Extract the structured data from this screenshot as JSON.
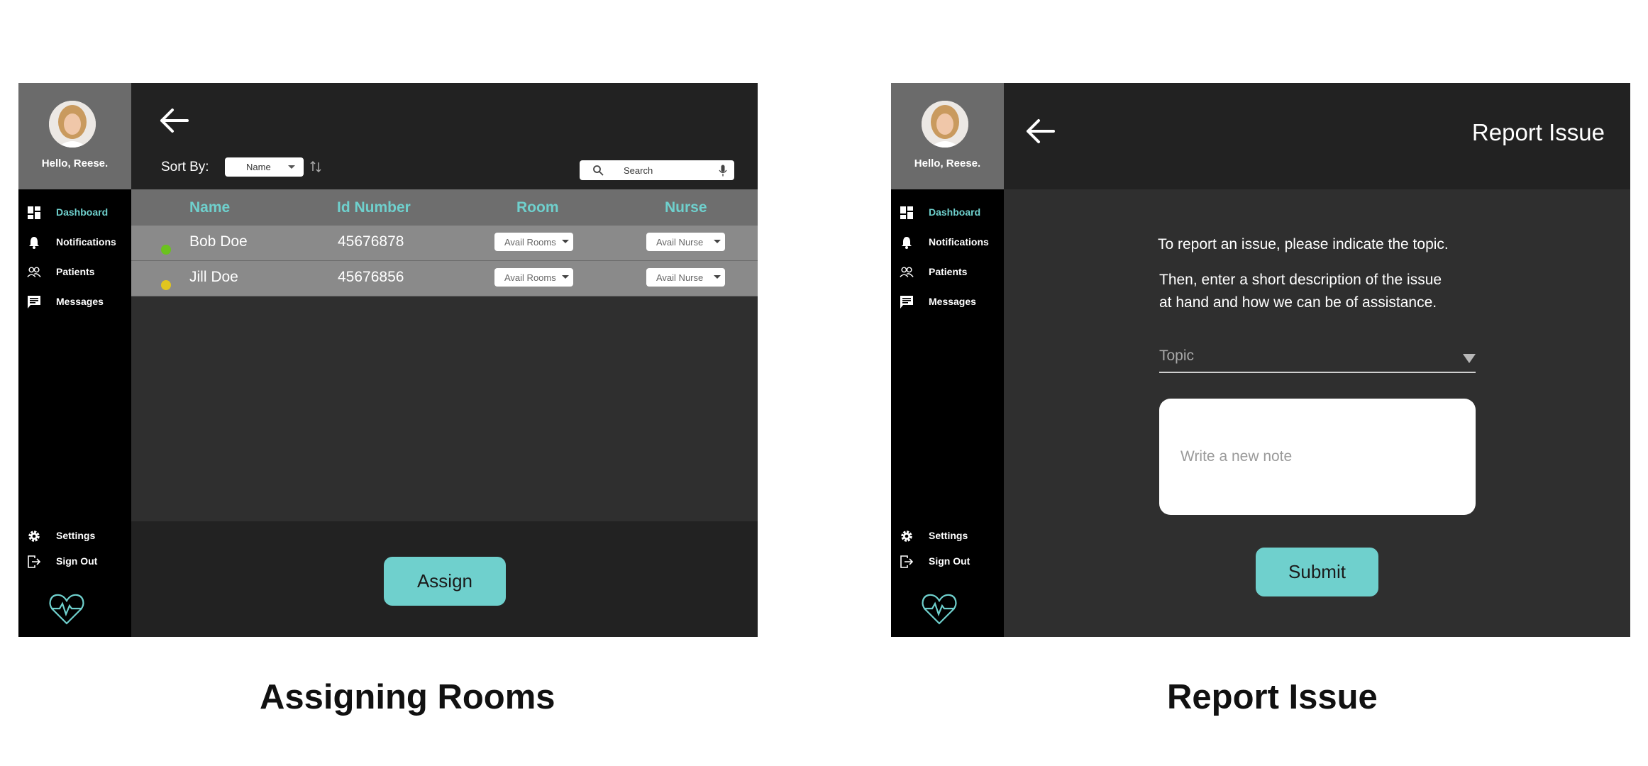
{
  "screens": {
    "assign": {
      "sidebar": {
        "greeting": "Hello, Reese.",
        "nav": [
          "Dashboard",
          "Notifications",
          "Patients",
          "Messages"
        ],
        "bottom_nav": [
          "Settings",
          "Sign Out"
        ],
        "active": "Dashboard"
      },
      "toolbar": {
        "sort_label": "Sort By:",
        "sort_value": "Name",
        "search_placeholder": "Search"
      },
      "table": {
        "headers": [
          "Name",
          "Id Number",
          "Room",
          "Nurse"
        ],
        "rows": [
          {
            "status_color": "#6bc21e",
            "name": "Bob Doe",
            "id": "45676878",
            "room": "Avail Rooms",
            "nurse": "Avail Nurse"
          },
          {
            "status_color": "#e1c51e",
            "name": "Jill Doe",
            "id": "45676856",
            "room": "Avail Rooms",
            "nurse": "Avail Nurse"
          }
        ]
      },
      "assign_button": "Assign",
      "caption": "Assigning Rooms"
    },
    "report": {
      "sidebar": {
        "greeting": "Hello, Reese.",
        "nav": [
          "Dashboard",
          "Notifications",
          "Patients",
          "Messages"
        ],
        "bottom_nav": [
          "Settings",
          "Sign Out"
        ],
        "active": "Dashboard"
      },
      "title": "Report Issue",
      "instructions": [
        "To report an issue, please indicate the topic.",
        "Then, enter a short description of the issue",
        "at hand and how we can be of assistance."
      ],
      "topic_placeholder": "Topic",
      "note_placeholder": "Write a new note",
      "submit_button": "Submit",
      "caption": "Report Issue"
    }
  },
  "colors": {
    "accent": "#6fd0cd",
    "sidebar": "#000000",
    "profile_bg": "#6b6b6b",
    "bar": "#222222",
    "content": "#2f2f2f"
  },
  "icons": [
    "dashboard-icon",
    "bell-icon",
    "people-icon",
    "message-icon",
    "gear-icon",
    "sign-out-icon",
    "heartbeat-logo-icon",
    "back-arrow-icon",
    "search-icon",
    "microphone-icon",
    "sort-toggle-icon"
  ]
}
